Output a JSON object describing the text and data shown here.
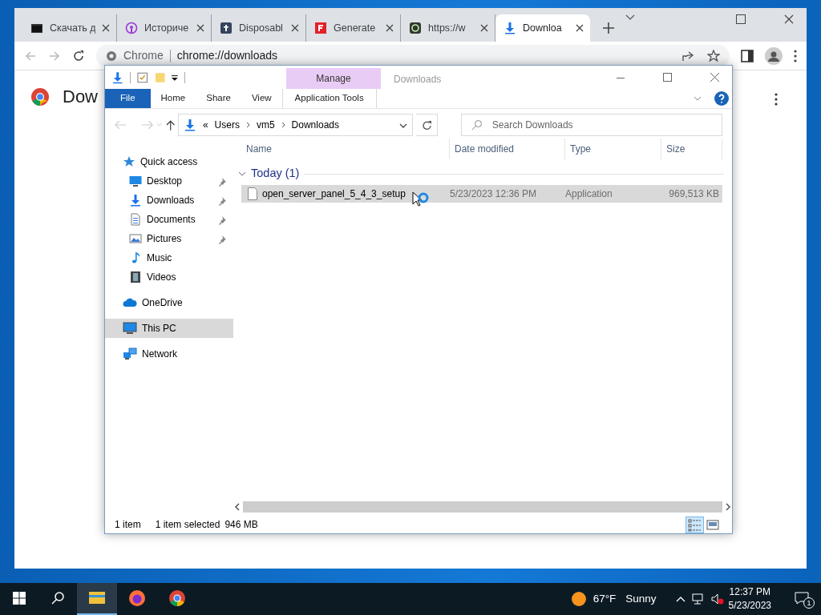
{
  "browser": {
    "tabs": [
      {
        "label": "Скачать д",
        "kind": "terminal",
        "selected": false
      },
      {
        "label": "Историче",
        "kind": "podcast",
        "selected": false
      },
      {
        "label": "Disposabl",
        "kind": "dark-square",
        "selected": false
      },
      {
        "label": "Generate",
        "kind": "red-square",
        "selected": false
      },
      {
        "label": "https://w",
        "kind": "green-square",
        "selected": false
      },
      {
        "label": "Downloa",
        "kind": "download",
        "selected": true
      }
    ],
    "address": {
      "site": "Chrome",
      "url": "chrome://downloads"
    },
    "page_title": "Dow"
  },
  "explorer": {
    "title": "Downloads",
    "context_group": "Manage",
    "ribbon_tabs": [
      {
        "label": "File",
        "kind": "file",
        "selected": false
      },
      {
        "label": "Home",
        "kind": "plain",
        "selected": false
      },
      {
        "label": "Share",
        "kind": "plain",
        "selected": false
      },
      {
        "label": "View",
        "kind": "plain",
        "selected": false
      },
      {
        "label": "Application Tools",
        "kind": "context",
        "selected": false
      }
    ],
    "breadcrumb_overflow": "«",
    "breadcrumb": [
      "Users",
      "vm5",
      "Downloads"
    ],
    "search": {
      "placeholder": "Search Downloads"
    },
    "nav": [
      {
        "label": "Quick access",
        "kind": "star",
        "selected": false,
        "children": [
          {
            "label": "Desktop",
            "kind": "desktop",
            "pinned": true,
            "selected": false
          },
          {
            "label": "Downloads",
            "kind": "download",
            "pinned": true,
            "selected": false
          },
          {
            "label": "Documents",
            "kind": "documents",
            "pinned": true,
            "selected": false
          },
          {
            "label": "Pictures",
            "kind": "pictures",
            "pinned": true,
            "selected": false
          },
          {
            "label": "Music",
            "kind": "music",
            "pinned": false,
            "selected": false
          },
          {
            "label": "Videos",
            "kind": "videos",
            "pinned": false,
            "selected": false
          }
        ]
      },
      {
        "label": "OneDrive",
        "kind": "cloud",
        "selected": false
      },
      {
        "label": "This PC",
        "kind": "pc",
        "selected": true
      },
      {
        "label": "Network",
        "kind": "network",
        "selected": false
      }
    ],
    "columns": [
      "Name",
      "Date modified",
      "Type",
      "Size"
    ],
    "groups": [
      {
        "label": "Today (1)",
        "expanded": true,
        "files": [
          {
            "name": "open_server_panel_5_4_3_setup",
            "date": "5/23/2023 12:36 PM",
            "type": "Application",
            "size": "969,513 KB",
            "selected": true
          }
        ]
      }
    ],
    "status": {
      "count": "1 item",
      "selection": "1 item selected",
      "size": "946 MB"
    },
    "views": [
      {
        "kind": "details",
        "selected": true
      },
      {
        "kind": "large",
        "selected": false
      }
    ]
  },
  "taskbar": {
    "apps": [
      {
        "kind": "explorer",
        "selected": true
      },
      {
        "kind": "firefox",
        "selected": false
      },
      {
        "kind": "chrome",
        "selected": false
      }
    ],
    "temperature": "67°F",
    "weather": "Sunny",
    "time": "12:37 PM",
    "date": "5/23/2023",
    "notifications": "1"
  }
}
